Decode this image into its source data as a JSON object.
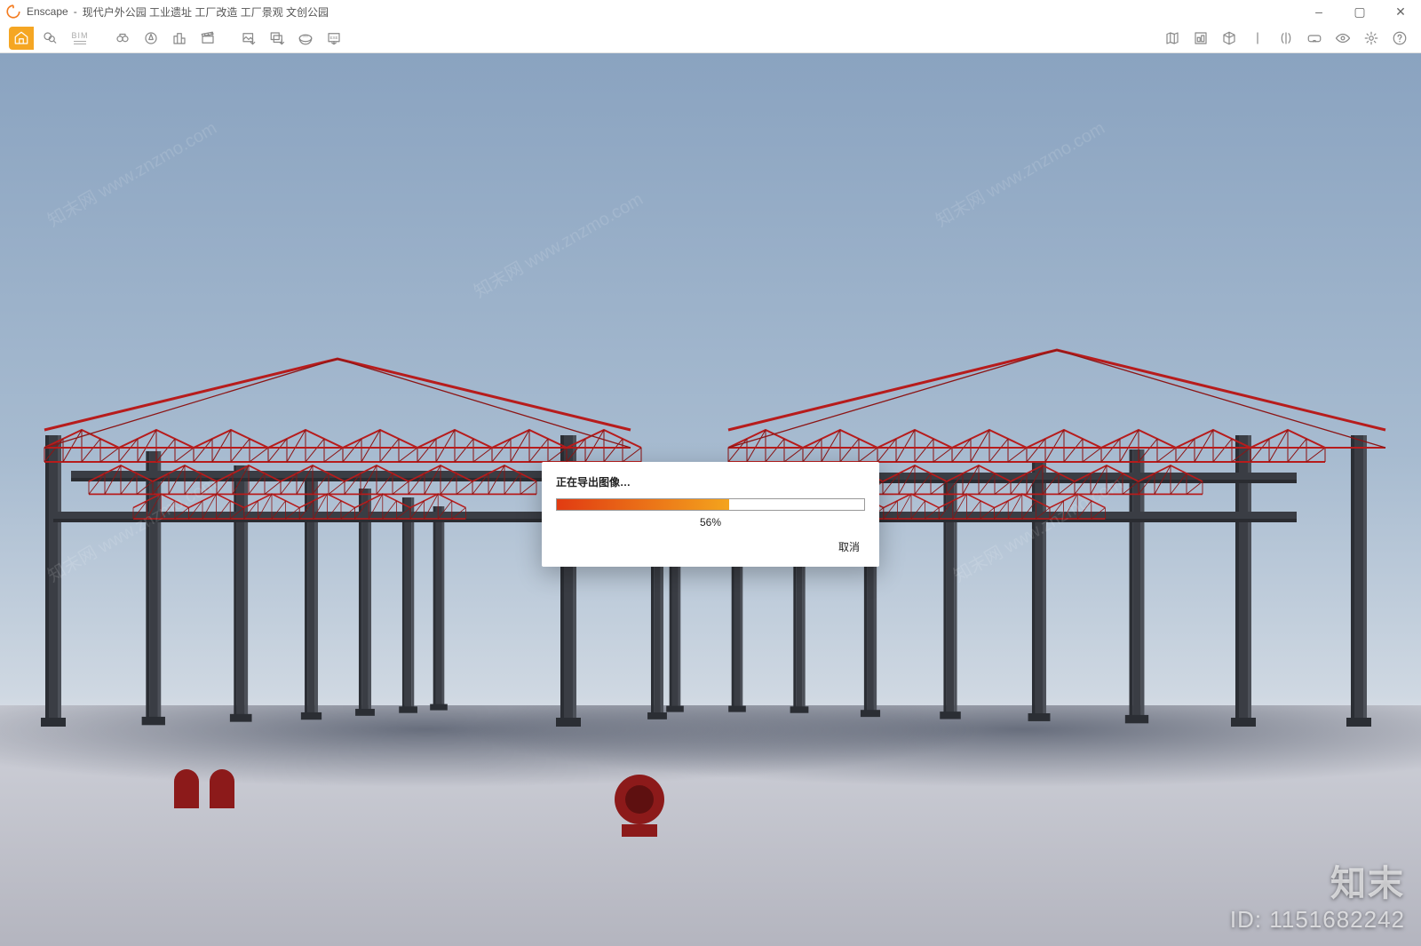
{
  "app": {
    "name": "Enscape",
    "document_title": "现代户外公园 工业遗址 工厂改造 工厂景观 文创公园"
  },
  "window_controls": {
    "minimize": "–",
    "maximize": "▢",
    "close": "✕"
  },
  "toolbar": {
    "left": [
      {
        "name": "home-icon",
        "glyph": "home"
      },
      {
        "name": "search-scene-icon",
        "glyph": "lens"
      },
      {
        "name": "bim-icon",
        "glyph": "bim",
        "label": "BIM"
      },
      {
        "name": "binoculars-icon",
        "glyph": "binoculars"
      },
      {
        "name": "compass-icon",
        "glyph": "compass"
      },
      {
        "name": "city-icon",
        "glyph": "city"
      },
      {
        "name": "clapper-icon",
        "glyph": "clapper"
      },
      {
        "name": "export-image-icon",
        "glyph": "export-img"
      },
      {
        "name": "export-batch-icon",
        "glyph": "export-batch"
      },
      {
        "name": "pano-icon",
        "glyph": "pano"
      },
      {
        "name": "exe-export-icon",
        "glyph": "exe"
      }
    ],
    "right": [
      {
        "name": "map-icon",
        "glyph": "map"
      },
      {
        "name": "asset-lib-icon",
        "glyph": "assets"
      },
      {
        "name": "cube-icon",
        "glyph": "cube"
      },
      {
        "name": "divider-icon",
        "glyph": "divider"
      },
      {
        "name": "mirror-icon",
        "glyph": "mirror"
      },
      {
        "name": "vr-icon",
        "glyph": "vr"
      },
      {
        "name": "eye-icon",
        "glyph": "eye"
      },
      {
        "name": "settings-icon",
        "glyph": "gear"
      },
      {
        "name": "help-icon",
        "glyph": "help"
      }
    ]
  },
  "dialog": {
    "title": "正在导出图像…",
    "percent": 56,
    "percent_label": "56%",
    "cancel": "取消"
  },
  "overlay": {
    "brand": "知末",
    "id_label": "ID: 1151682242",
    "watermark": "知末网 www.znzmo.com"
  }
}
